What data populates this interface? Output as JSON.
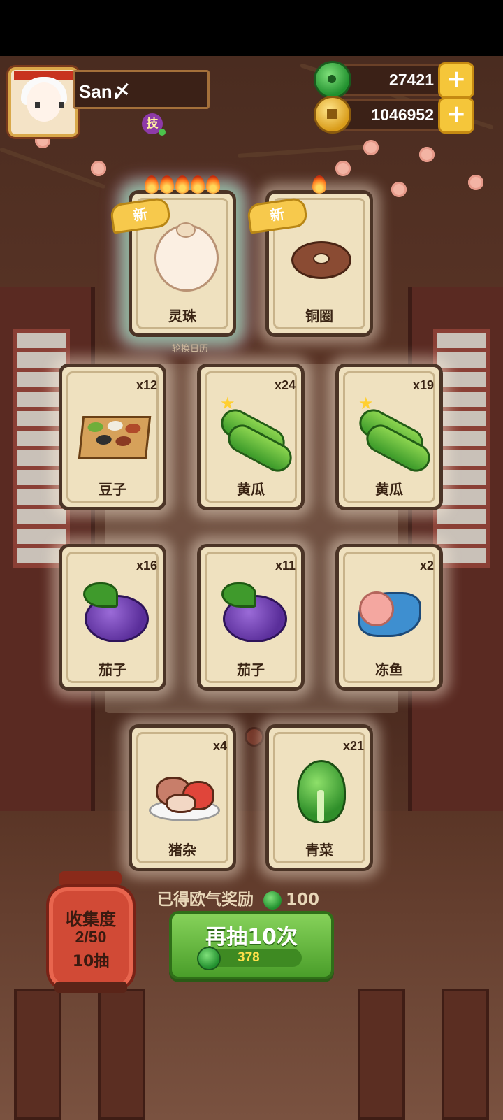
{
  "player": {
    "name": "San〆",
    "skill_badge": "技"
  },
  "currency": {
    "jade": "27421",
    "coins": "1046952",
    "plus": "+"
  },
  "caption": "轮换日历",
  "new_tag": "新",
  "top_cards": [
    {
      "name": "灵珠",
      "stars": 5,
      "is_new": true,
      "icon": "spirit-pearl-baby"
    },
    {
      "name": "铜圈",
      "stars": 1,
      "is_new": true,
      "icon": "copper-ring"
    }
  ],
  "cards": [
    {
      "name": "豆子",
      "qty": "x12",
      "icon": "beans-tray"
    },
    {
      "name": "黄瓜",
      "qty": "x24",
      "icon": "cucumber"
    },
    {
      "name": "黄瓜",
      "qty": "x19",
      "icon": "cucumber"
    },
    {
      "name": "茄子",
      "qty": "x16",
      "icon": "eggplant"
    },
    {
      "name": "茄子",
      "qty": "x11",
      "icon": "eggplant"
    },
    {
      "name": "冻鱼",
      "qty": "x2",
      "icon": "frozen-fish"
    },
    {
      "name": "猪杂",
      "qty": "x4",
      "icon": "pork-offal"
    },
    {
      "name": "青菜",
      "qty": "x21",
      "icon": "green-vegetable"
    }
  ],
  "collection": {
    "title": "收集度",
    "progress": "2/50",
    "draws": "10抽"
  },
  "reward": {
    "label": "已得欧气奖励",
    "amount": "100"
  },
  "draw_button": {
    "label": "再抽10次",
    "cost": "378"
  }
}
